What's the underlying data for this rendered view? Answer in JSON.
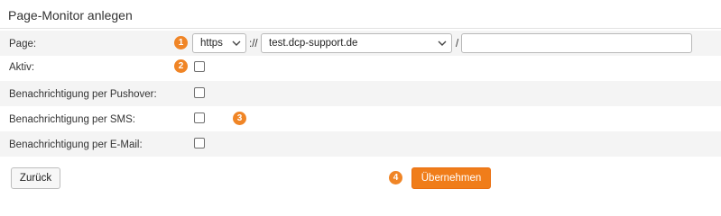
{
  "page": {
    "title": "Page-Monitor anlegen"
  },
  "colors": {
    "accent": "#f07d1a",
    "badge": "#f08526"
  },
  "form": {
    "page_label": "Page:",
    "protocol_value": "https",
    "protocol_separator": "://",
    "domain_value": "test.dcp-support.de",
    "path_separator": "/",
    "path_value": "",
    "active_label": "Aktiv:",
    "pushover_label": "Benachrichtigung per Pushover:",
    "sms_label": "Benachrichtigung per SMS:",
    "email_label": "Benachrichtigung per E-Mail:"
  },
  "badges": {
    "one": "1",
    "two": "2",
    "three": "3",
    "four": "4"
  },
  "buttons": {
    "back_label": "Zurück",
    "apply_label": "Übernehmen"
  },
  "icons": {
    "select_arrow": "chevron-down-icon"
  }
}
